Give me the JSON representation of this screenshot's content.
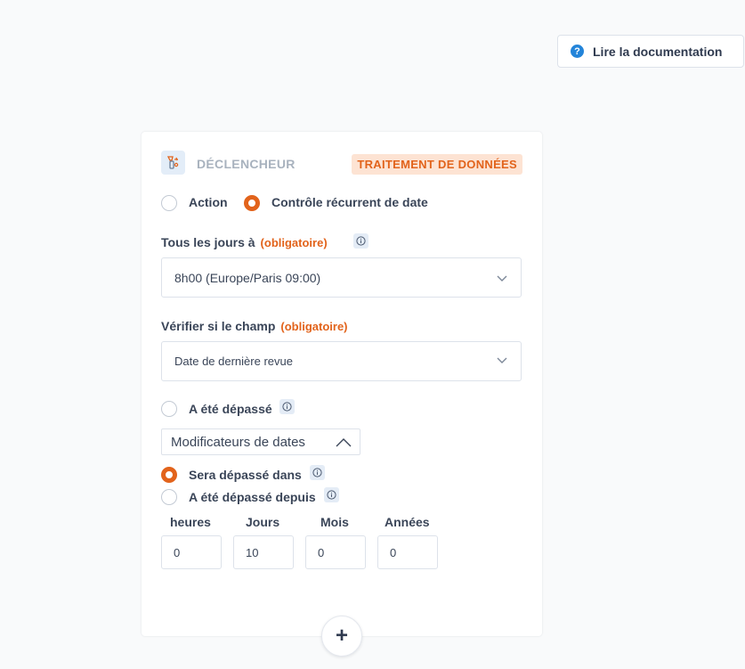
{
  "doc_button": {
    "label": "Lire la documentation",
    "icon": "question-circle-icon"
  },
  "card": {
    "header": {
      "title": "DÉCLENCHEUR",
      "badge": "TRAITEMENT DE DONNÉES",
      "icon": "trigger-icon"
    },
    "trigger_type": {
      "options": [
        {
          "label": "Action",
          "checked": false
        },
        {
          "label": "Contrôle récurrent de date",
          "checked": true
        }
      ]
    },
    "time_field": {
      "label": "Tous les jours à",
      "required": "(obligatoire)",
      "value": "8h00 (Europe/Paris 09:00)"
    },
    "date_field": {
      "label": "Vérifier si le champ",
      "required": "(obligatoire)",
      "value": "Date de dernière revue"
    },
    "condition_passed": {
      "label": "A été dépassé",
      "checked": false
    },
    "modifiers": {
      "label": "Modificateurs de dates"
    },
    "modifier_options": [
      {
        "label": "Sera dépassé dans",
        "checked": true
      },
      {
        "label": "A été dépassé depuis",
        "checked": false
      }
    ],
    "durations": [
      {
        "label": "heures",
        "value": "0"
      },
      {
        "label": "Jours",
        "value": "10"
      },
      {
        "label": "Mois",
        "value": "0"
      },
      {
        "label": "Années",
        "value": "0"
      }
    ]
  },
  "add_button": {
    "label": "+"
  },
  "colors": {
    "accent": "#e2631b",
    "badge_bg": "#fde3d3",
    "info_blue": "#2384d9"
  }
}
